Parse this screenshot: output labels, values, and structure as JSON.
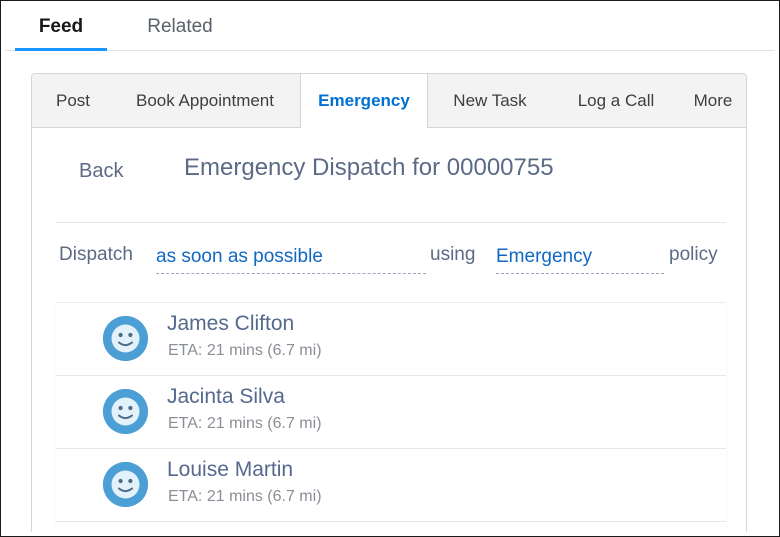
{
  "record_tabs": [
    {
      "label": "Feed",
      "active": true
    },
    {
      "label": "Related",
      "active": false
    }
  ],
  "publisher_tabs": [
    {
      "label": "Post",
      "active": false
    },
    {
      "label": "Book Appointment",
      "active": false
    },
    {
      "label": "Emergency",
      "active": true
    },
    {
      "label": "New Task",
      "active": false
    },
    {
      "label": "Log a Call",
      "active": false
    },
    {
      "label": "More",
      "active": false
    }
  ],
  "header": {
    "back_label": "Back",
    "title": "Emergency Dispatch for 00000755"
  },
  "sentence": {
    "lead": "Dispatch",
    "when_value": "as soon as possible",
    "mid": "using",
    "policy_value": "Emergency",
    "tail": "policy"
  },
  "resources": [
    {
      "name": "James Clifton",
      "eta": "ETA: 21 mins (6.7 mi)",
      "avatar_icon": "smiley-face-avatar-icon"
    },
    {
      "name": "Jacinta Silva",
      "eta": "ETA: 21 mins (6.7 mi)",
      "avatar_icon": "smiley-face-avatar-icon"
    },
    {
      "name": "Louise Martin",
      "eta": "ETA: 21 mins (6.7 mi)",
      "avatar_icon": "smiley-face-avatar-icon"
    }
  ],
  "colors": {
    "accent_blue": "#1b96ff",
    "link_blue": "#0070d2",
    "field_blue": "#1168c4",
    "title_slate": "#5c6b85",
    "avatar_blue": "#4b9fd5",
    "avatar_face": "#e8f4fb"
  }
}
